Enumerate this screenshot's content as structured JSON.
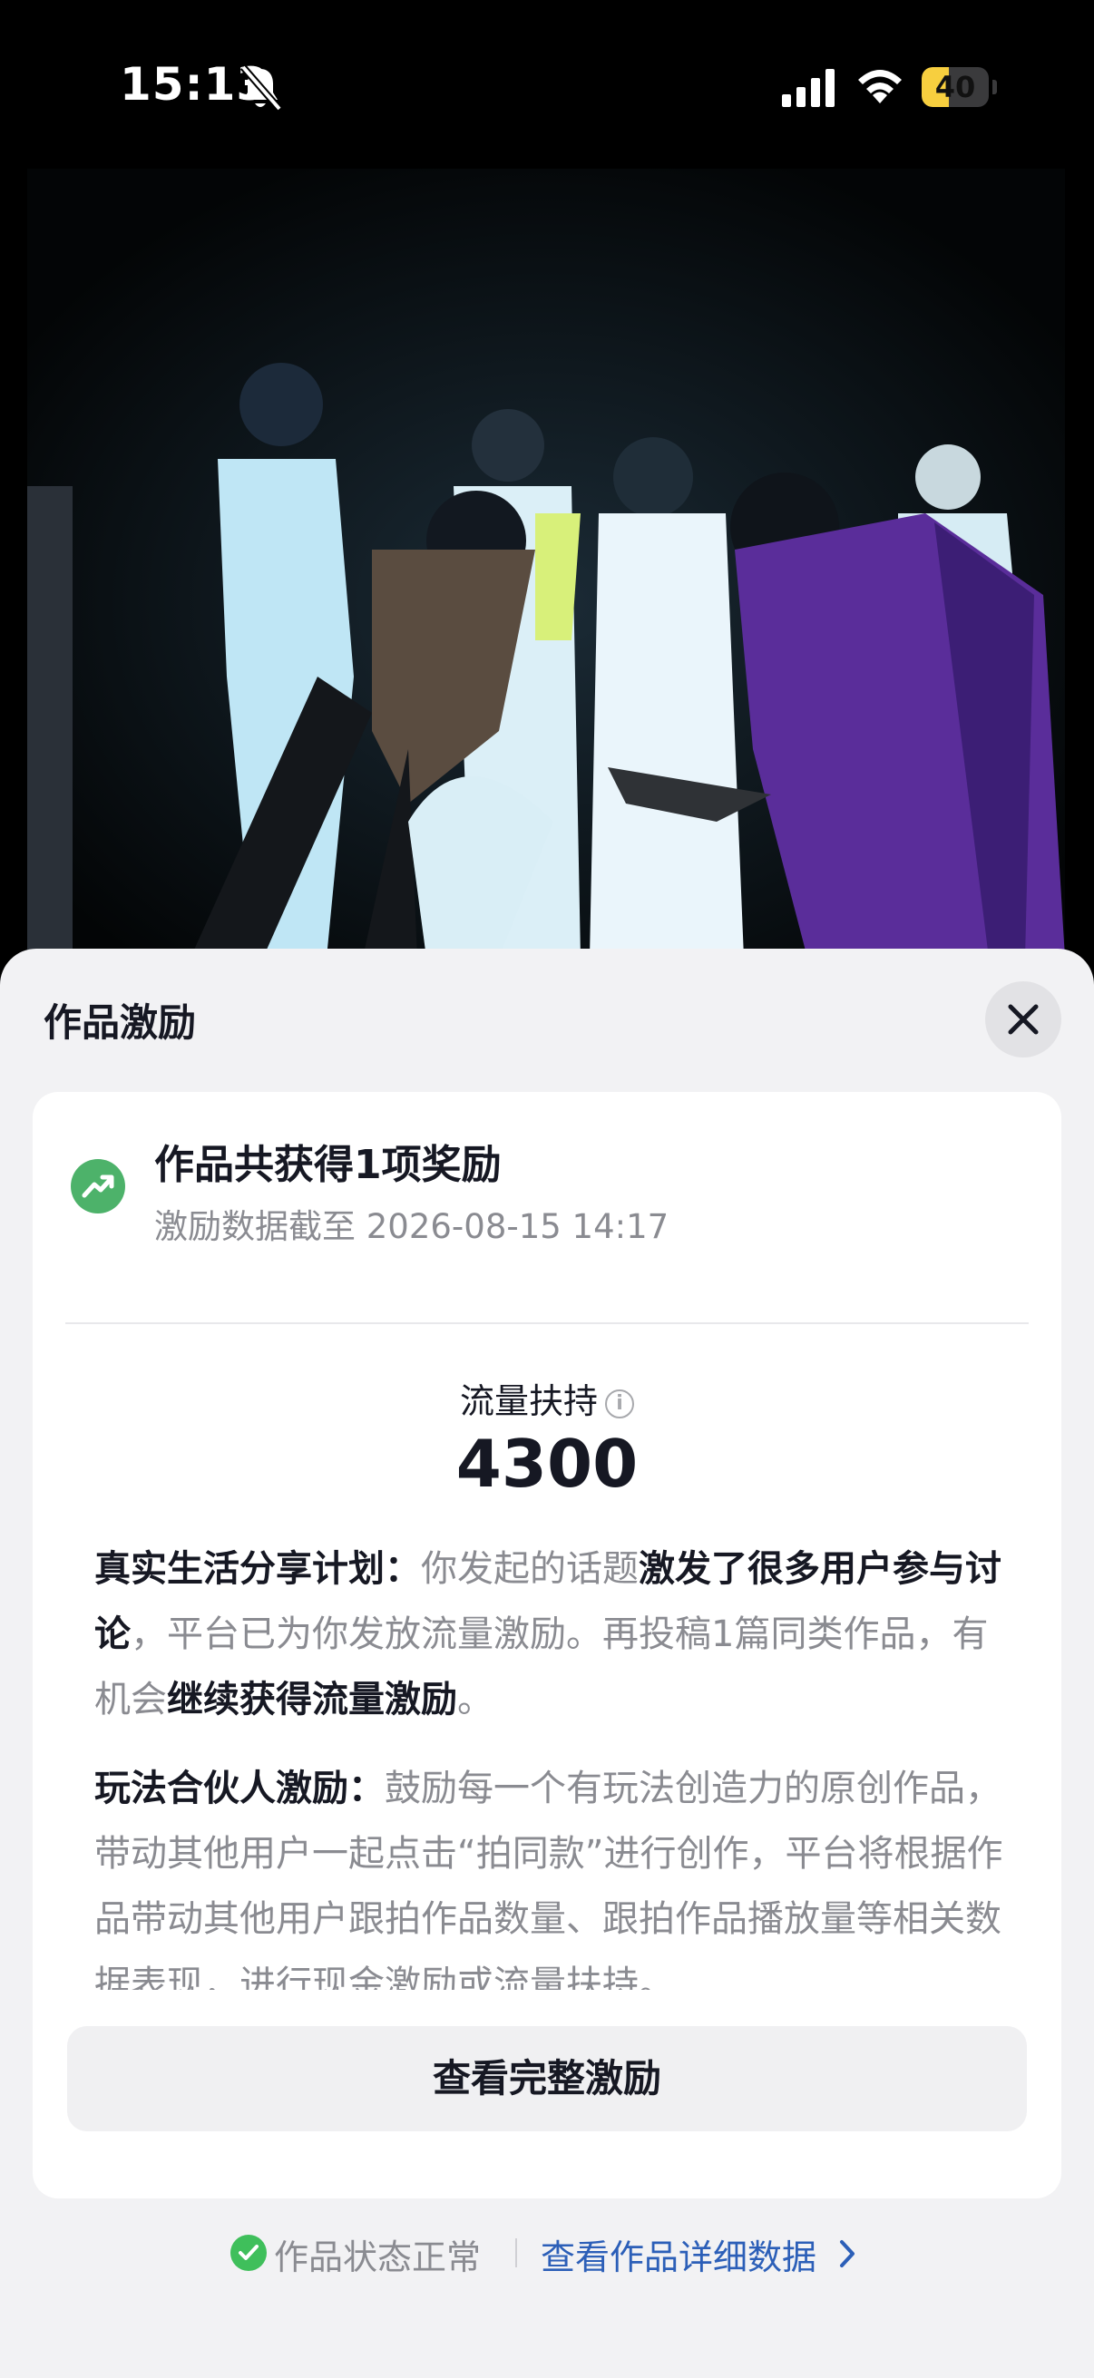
{
  "status_bar": {
    "time": "15:13",
    "battery_level": "40",
    "battery_fraction": 0.4,
    "icons": [
      "bell-slash-icon",
      "cellular-signal-icon",
      "wifi-icon",
      "battery-icon"
    ]
  },
  "video": {
    "icon": "dance-performance-frame"
  },
  "sheet": {
    "title": "作品激励",
    "close_icon": "close-icon"
  },
  "card": {
    "title": "作品共获得1项奖励",
    "subtitle": "激励数据截至 2026-08-15 14:17",
    "metric_label": "流量扶持",
    "metric_value": "4300",
    "info_glyph": "i",
    "items": [
      {
        "name": "真实生活分享计划：",
        "t1": "你发起的话题",
        "b1": "激发了很多用户参与讨论",
        "t2": "，平台已为你发放流量激励。再投稿1篇同类作品，有机会",
        "b2": "继续获得流量激励",
        "t3": "。"
      },
      {
        "name": "玩法合伙人激励：",
        "t1": "鼓励每一个有玩法创造力的原创作品，带动其他用户一起点击“拍同款”进行创作，平台将根据作品带动其他用户跟拍作品数量、跟拍作品播放量等相关数据表现，进行现金激励或流量扶持。"
      }
    ],
    "full_button": "查看完整激励"
  },
  "footer": {
    "status": "作品状态正常",
    "detail_link": "查看作品详细数据"
  },
  "colors": {
    "accent_green": "#4db26a",
    "link_blue": "#2c5fb8",
    "battery_yellow": "#f7cf3f",
    "sheet_bg": "#f2f2f4"
  }
}
